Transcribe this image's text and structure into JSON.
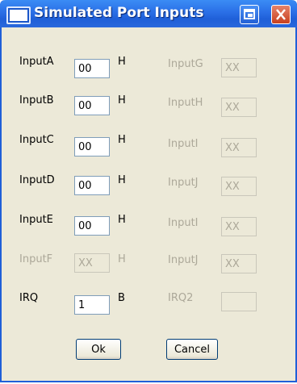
{
  "window": {
    "title": "Simulated Port Inputs"
  },
  "left_rows": [
    {
      "label": "InputA",
      "value": "00",
      "unit": "H"
    },
    {
      "label": "InputB",
      "value": "00",
      "unit": "H"
    },
    {
      "label": "InputC",
      "value": "00",
      "unit": "H"
    },
    {
      "label": "InputD",
      "value": "00",
      "unit": "H"
    },
    {
      "label": "InputE",
      "value": "00",
      "unit": "H"
    },
    {
      "label": "InputF",
      "value": "XX",
      "unit": "H"
    },
    {
      "label": "IRQ",
      "value": "1",
      "unit": "B"
    }
  ],
  "right_rows": [
    {
      "label": "InputG",
      "value": "XX"
    },
    {
      "label": "InputH",
      "value": "XX"
    },
    {
      "label": "InputI",
      "value": "XX"
    },
    {
      "label": "InputJ",
      "value": "XX"
    },
    {
      "label": "InputI",
      "value": "XX"
    },
    {
      "label": "InputJ",
      "value": "XX"
    },
    {
      "label": "IRQ2",
      "value": ""
    }
  ],
  "buttons": {
    "ok": "Ok",
    "cancel": "Cancel"
  },
  "colors": {
    "titlebar": "#1f5fd8",
    "dialog_bg": "#ece9d8",
    "disabled_text": "#aca899"
  }
}
